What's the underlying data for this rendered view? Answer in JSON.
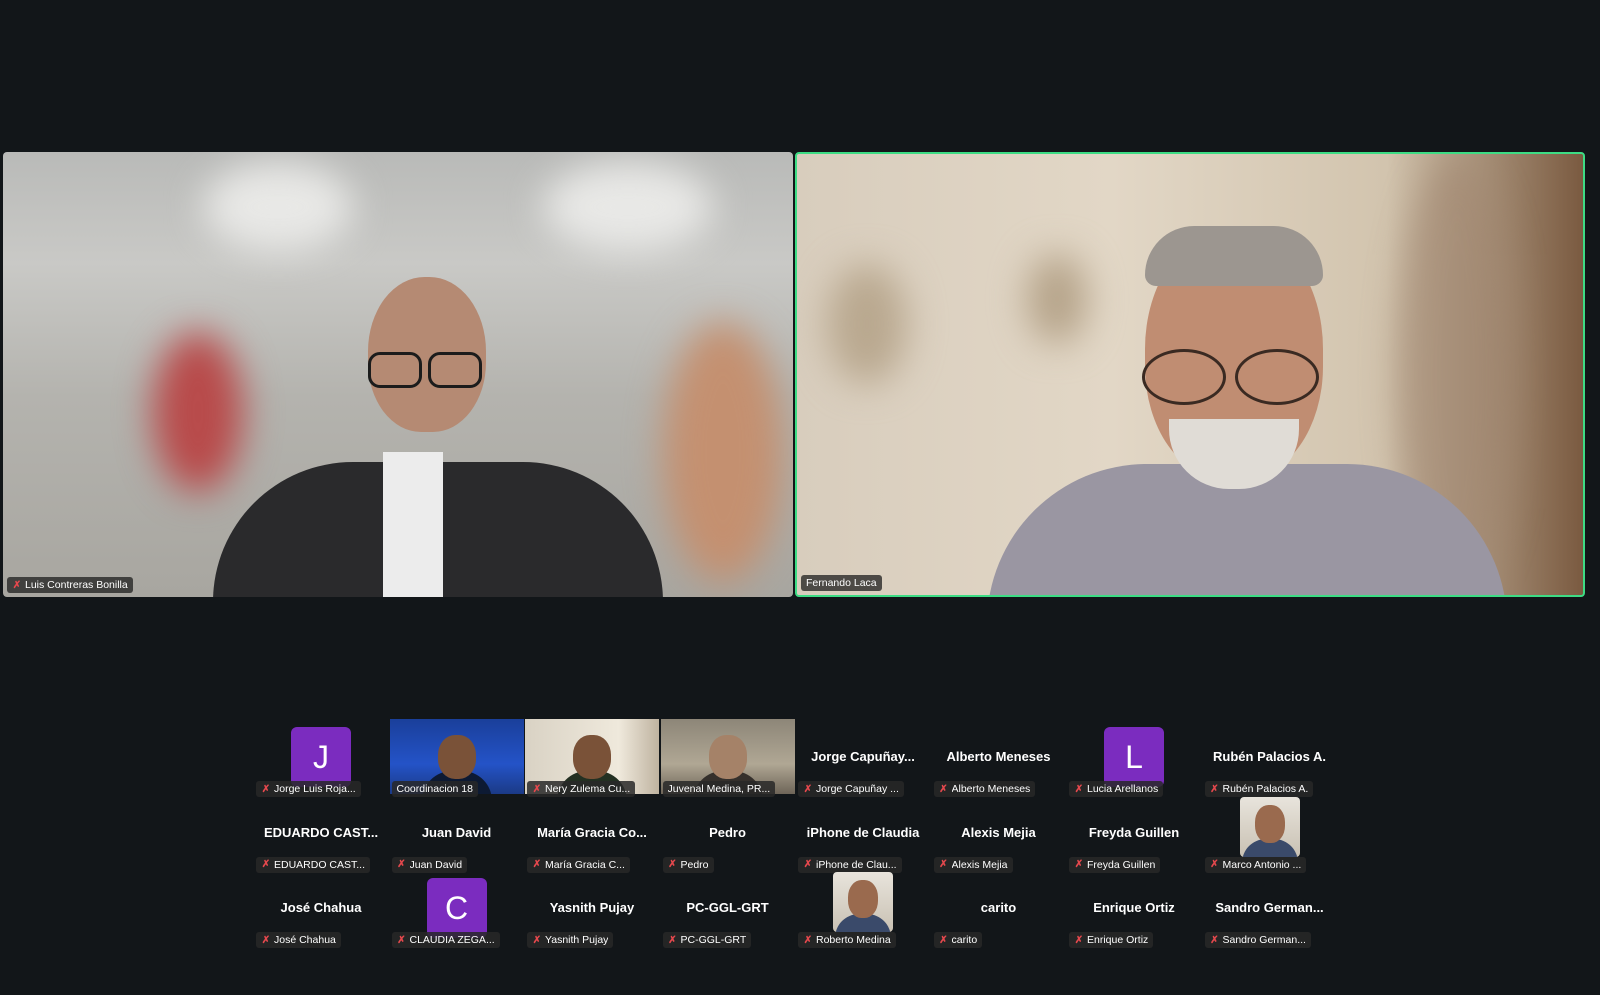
{
  "speakers": [
    {
      "name": "Luis Contreras Bonilla",
      "muted": true
    },
    {
      "name": "Fernando Laca",
      "muted": false,
      "active": true
    }
  ],
  "participants": [
    {
      "label": "Jorge Luis Roja...",
      "kind": "initial",
      "initial": "J",
      "muted": true
    },
    {
      "label": "Coordinacion 18",
      "kind": "video",
      "muted": false
    },
    {
      "label": "Nery Zulema Cu...",
      "kind": "video",
      "muted": true
    },
    {
      "label": "Juvenal Medina, PR...",
      "kind": "video",
      "muted": false
    },
    {
      "label": "Jorge Capuñay ...",
      "kind": "name",
      "display": "Jorge  Capuñay...",
      "muted": true
    },
    {
      "label": "Alberto Meneses",
      "kind": "name",
      "display": "Alberto Meneses",
      "muted": true
    },
    {
      "label": "Lucia Arellanos",
      "kind": "initial",
      "initial": "L",
      "muted": true
    },
    {
      "label": "Rubén Palacios A.",
      "kind": "name",
      "display": "Rubén Palacios A.",
      "muted": true
    },
    {
      "label": "EDUARDO CAST...",
      "kind": "name",
      "display": "EDUARDO  CAST...",
      "muted": true
    },
    {
      "label": "Juan David",
      "kind": "name",
      "display": "Juan David",
      "muted": true
    },
    {
      "label": "María Gracia C...",
      "kind": "name",
      "display": "María  Gracia  Co...",
      "muted": true
    },
    {
      "label": "Pedro",
      "kind": "name",
      "display": "Pedro",
      "muted": true
    },
    {
      "label": "iPhone de Clau...",
      "kind": "name",
      "display": "iPhone de Claudia",
      "muted": true
    },
    {
      "label": "Alexis Mejia",
      "kind": "name",
      "display": "Alexis Mejia",
      "muted": true
    },
    {
      "label": "Freyda Guillen",
      "kind": "name",
      "display": "Freyda Guillen",
      "muted": true
    },
    {
      "label": "Marco Antonio ...",
      "kind": "photo",
      "muted": true
    },
    {
      "label": "José Chahua",
      "kind": "name",
      "display": "José Chahua",
      "muted": true
    },
    {
      "label": "CLAUDIA  ZEGA...",
      "kind": "initial",
      "initial": "C",
      "muted": true
    },
    {
      "label": "Yasnith Pujay",
      "kind": "name",
      "display": "Yasnith Pujay",
      "muted": true
    },
    {
      "label": "PC-GGL-GRT",
      "kind": "name",
      "display": "PC-GGL-GRT",
      "muted": true
    },
    {
      "label": "Roberto Medina",
      "kind": "photo",
      "muted": true
    },
    {
      "label": "carito",
      "kind": "name",
      "display": "carito",
      "muted": true
    },
    {
      "label": "Enrique Ortiz",
      "kind": "name",
      "display": "Enrique Ortiz",
      "muted": true
    },
    {
      "label": "Sandro German...",
      "kind": "name",
      "display": "Sandro  German...",
      "muted": true
    }
  ],
  "icons": {
    "muted": "mic-off-icon"
  },
  "colors": {
    "active_border": "#3ddc84",
    "avatar_bg": "#7b2cbf",
    "mute_red": "#e5484d"
  }
}
